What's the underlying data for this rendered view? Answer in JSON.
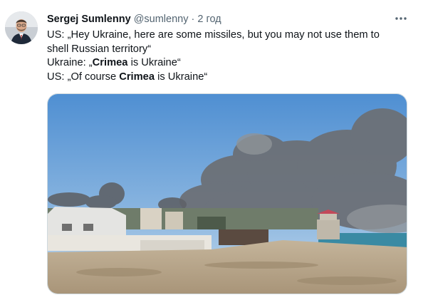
{
  "tweet": {
    "author": {
      "display_name": "Sergej Sumlenny",
      "handle": "@sumlenny",
      "separator": "·",
      "time": "2 год"
    },
    "more_icon": "more-horizontal-icon",
    "text_lines": [
      [
        "US: „Hey Ukraine, here are some missiles, but you may not use them to"
      ],
      [
        "shell Russian territory“"
      ],
      [
        "Ukraine: „",
        "Crimea",
        " is Ukraine“"
      ],
      [
        "US: „Of course ",
        "Crimea",
        " is Ukraine“"
      ]
    ],
    "media": {
      "kind": "photo",
      "depicts": "beach-with-smoke-plumes"
    }
  }
}
